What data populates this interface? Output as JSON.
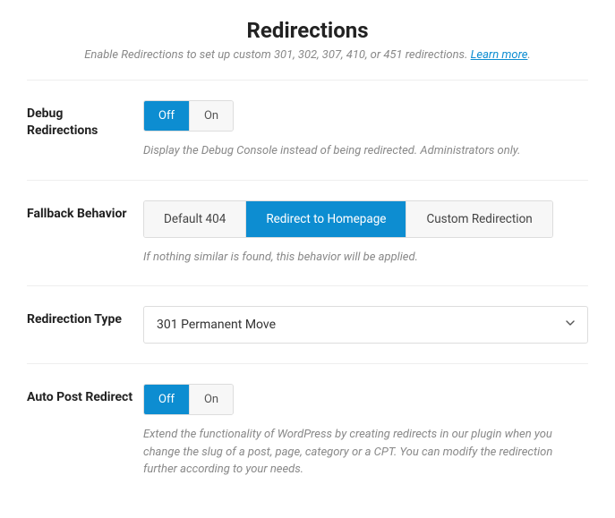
{
  "header": {
    "title": "Redirections",
    "subtitle_prefix": "Enable Redirections to set up custom 301, 302, 307, 410, or 451 redirections. ",
    "learn_more": "Learn more",
    "subtitle_suffix": "."
  },
  "debug": {
    "label": "Debug Redirections",
    "off": "Off",
    "on": "On",
    "active": "off",
    "help": "Display the Debug Console instead of being redirected. Administrators only."
  },
  "fallback": {
    "label": "Fallback Behavior",
    "options": [
      "Default 404",
      "Redirect to Homepage",
      "Custom Redirection"
    ],
    "active_index": 1,
    "help": "If nothing similar is found, this behavior will be applied."
  },
  "redirection_type": {
    "label": "Redirection Type",
    "selected": "301 Permanent Move"
  },
  "auto_post": {
    "label": "Auto Post Redirect",
    "off": "Off",
    "on": "On",
    "active": "off",
    "help": "Extend the functionality of WordPress by creating redirects in our plugin when you change the slug of a post, page, category or a CPT. You can modify the redirection further according to your needs."
  }
}
